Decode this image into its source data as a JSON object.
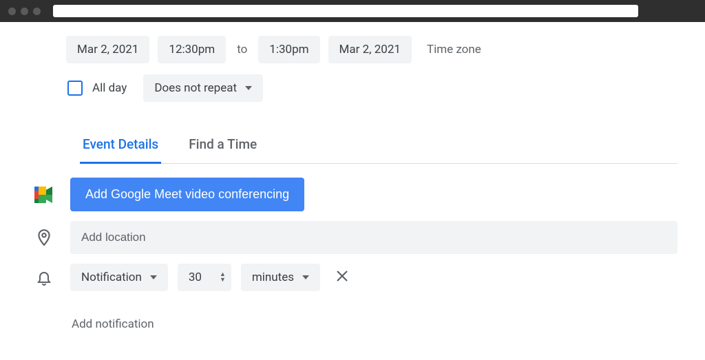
{
  "datetime": {
    "start_date": "Mar 2, 2021",
    "start_time": "12:30pm",
    "to_label": "to",
    "end_time": "1:30pm",
    "end_date": "Mar 2, 2021",
    "timezone_label": "Time zone"
  },
  "allday": {
    "label": "All day",
    "checked": false
  },
  "recurrence": {
    "value": "Does not repeat"
  },
  "tabs": {
    "details": "Event Details",
    "findtime": "Find a Time"
  },
  "meet": {
    "button_label": "Add Google Meet video conferencing"
  },
  "location": {
    "placeholder": "Add location",
    "value": ""
  },
  "notification": {
    "type": "Notification",
    "value": "30",
    "unit": "minutes",
    "add_label": "Add notification"
  }
}
